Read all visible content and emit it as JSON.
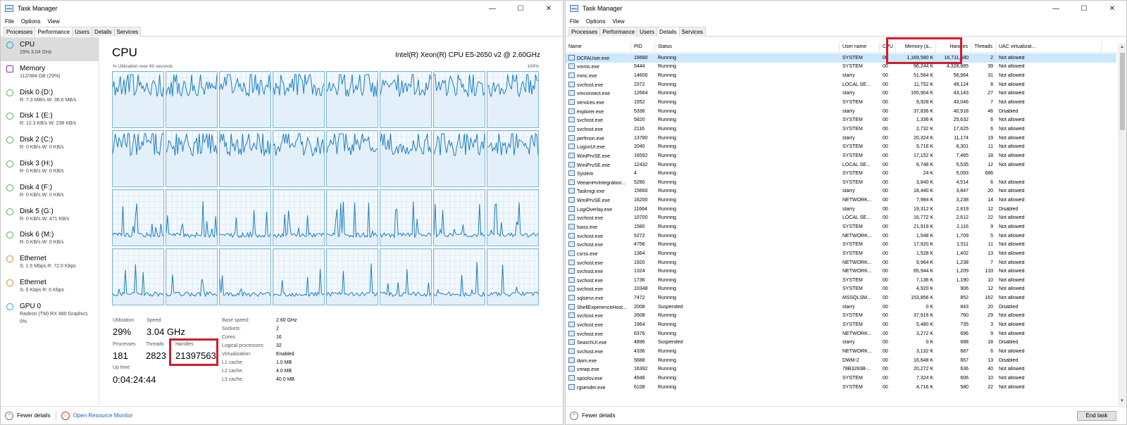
{
  "left": {
    "title": "Task Manager",
    "menu": [
      "File",
      "Options",
      "View"
    ],
    "tabs": [
      "Processes",
      "Performance",
      "Users",
      "Details",
      "Services"
    ],
    "active_tab": "Performance",
    "sidebar": [
      {
        "name": "CPU",
        "sub": "29% 3.04 GHz",
        "color": "#17a2d8",
        "active": true
      },
      {
        "name": "Memory",
        "sub": "112/384 GB (29%)",
        "color": "#8b2fb0"
      },
      {
        "name": "Disk 0 (D:)",
        "sub": "R: 7.3 MB/s W: 36.6 MB/s",
        "color": "#4caf50"
      },
      {
        "name": "Disk 1 (E:)",
        "sub": "R: 12.3 KB/s W: 238 KB/s",
        "color": "#4caf50"
      },
      {
        "name": "Disk 2 (C:)",
        "sub": "R: 0 KB/s W: 0 KB/s",
        "color": "#4caf50"
      },
      {
        "name": "Disk 3 (H:)",
        "sub": "R: 0 KB/s W: 0 KB/s",
        "color": "#4caf50"
      },
      {
        "name": "Disk 4 (F:)",
        "sub": "R: 0 KB/s W: 0 KB/s",
        "color": "#4caf50"
      },
      {
        "name": "Disk 5 (G:)",
        "sub": "R: 0 KB/s W: 471 KB/s",
        "color": "#4caf50"
      },
      {
        "name": "Disk 6 (M:)",
        "sub": "R: 0 KB/s W: 0 KB/s",
        "color": "#4caf50"
      },
      {
        "name": "Ethernet",
        "sub": "S: 1.5 Mbps R: 72.0 Kbps",
        "color": "#d9822b"
      },
      {
        "name": "Ethernet",
        "sub": "S: 0 Kbps R: 0 Kbps",
        "color": "#d9822b"
      },
      {
        "name": "GPU 0",
        "sub": "Radeon (TM) RX 480 Graphics",
        "sub2": "0%",
        "color": "#17a2d8"
      }
    ],
    "cpu": {
      "title": "CPU",
      "model": "Intel(R) Xeon(R) CPU E5-2650 v2 @ 2.60GHz",
      "util_label": "% Utilization over 60 seconds",
      "util_max": "100%",
      "utilization_label": "Utilization",
      "utilization": "29%",
      "speed_label": "Speed",
      "speed": "3.04 GHz",
      "processes_label": "Processes",
      "processes": "181",
      "threads_label": "Threads",
      "threads": "2823",
      "handles_label": "Handles",
      "handles": "21397563",
      "uptime_label": "Up time",
      "uptime": "0:04:24:44",
      "specs": [
        {
          "k": "Base speed:",
          "v": "2.60 GHz"
        },
        {
          "k": "Sockets:",
          "v": "2"
        },
        {
          "k": "Cores:",
          "v": "16"
        },
        {
          "k": "Logical processors:",
          "v": "32"
        },
        {
          "k": "Virtualization:",
          "v": "Enabled"
        },
        {
          "k": "L1 cache:",
          "v": "1.0 MB"
        },
        {
          "k": "L2 cache:",
          "v": "4.0 MB"
        },
        {
          "k": "L3 cache:",
          "v": "40.0 MB"
        }
      ]
    },
    "footer": {
      "fewer": "Fewer details",
      "open_rm": "Open Resource Monitor"
    }
  },
  "right": {
    "title": "Task Manager",
    "menu": [
      "File",
      "Options",
      "View"
    ],
    "tabs": [
      "Processes",
      "Performance",
      "Users",
      "Details",
      "Services"
    ],
    "active_tab": "Details",
    "columns": [
      "Name",
      "PID",
      "Status",
      "User name",
      "CPU",
      "Memory (a...",
      "Handles",
      "Threads",
      "UAC virtualizat..."
    ],
    "rows": [
      [
        "DCFAUser.exe",
        "16680",
        "Running",
        "SYSTEM",
        "00",
        "1,169,580 K",
        "16,711,680",
        "2",
        "Not allowed"
      ],
      [
        "vmms.exe",
        "5444",
        "Running",
        "SYSTEM",
        "00",
        "96,244 K",
        "4,328,985",
        "39",
        "Not allowed"
      ],
      [
        "mmc.exe",
        "14600",
        "Running",
        "starry",
        "00",
        "51,564 K",
        "56,964",
        "31",
        "Not allowed"
      ],
      [
        "svchost.exe",
        "2372",
        "Running",
        "LOCAL SE...",
        "00",
        "11,752 K",
        "49,124",
        "8",
        "Not allowed"
      ],
      [
        "vmconnect.exe",
        "12664",
        "Running",
        "starry",
        "00",
        "165,904 K",
        "43,143",
        "27",
        "Not allowed"
      ],
      [
        "services.exe",
        "1552",
        "Running",
        "SYSTEM",
        "00",
        "9,928 K",
        "43,046",
        "7",
        "Not allowed"
      ],
      [
        "explorer.exe",
        "5336",
        "Running",
        "starry",
        "00",
        "37,836 K",
        "40,918",
        "46",
        "Disabled"
      ],
      [
        "svchost.exe",
        "5820",
        "Running",
        "SYSTEM",
        "00",
        "1,336 K",
        "25,632",
        "6",
        "Not allowed"
      ],
      [
        "svchost.exe",
        "2116",
        "Running",
        "SYSTEM",
        "00",
        "2,732 K",
        "17,625",
        "6",
        "Not allowed"
      ],
      [
        "perfmon.exe",
        "13780",
        "Running",
        "starry",
        "00",
        "20,324 K",
        "11,174",
        "19",
        "Not allowed"
      ],
      [
        "LogonUI.exe",
        "2040",
        "Running",
        "SYSTEM",
        "00",
        "9,716 K",
        "8,301",
        "11",
        "Not allowed"
      ],
      [
        "WmiPrvSE.exe",
        "16592",
        "Running",
        "SYSTEM",
        "00",
        "17,152 K",
        "7,465",
        "18",
        "Not allowed"
      ],
      [
        "WmiPrvSE.exe",
        "12432",
        "Running",
        "LOCAL SE...",
        "00",
        "6,748 K",
        "5,535",
        "12",
        "Not allowed"
      ],
      [
        "System",
        "4",
        "Running",
        "SYSTEM",
        "00",
        "24 K",
        "5,093",
        "686",
        ""
      ],
      [
        "VeeamHvIntegration...",
        "5280",
        "Running",
        "SYSTEM",
        "00",
        "3,840 K",
        "4,514",
        "6",
        "Not allowed"
      ],
      [
        "Taskmgr.exe",
        "15660",
        "Running",
        "starry",
        "00",
        "18,440 K",
        "3,847",
        "20",
        "Not allowed"
      ],
      [
        "WmiPrvSE.exe",
        "16200",
        "Running",
        "NETWORK...",
        "00",
        "7,984 K",
        "3,238",
        "14",
        "Not allowed"
      ],
      [
        "LogiOverlay.exe",
        "11664",
        "Running",
        "starry",
        "00",
        "19,312 K",
        "2,819",
        "12",
        "Disabled"
      ],
      [
        "svchost.exe",
        "10700",
        "Running",
        "LOCAL SE...",
        "00",
        "16,772 K",
        "2,612",
        "22",
        "Not allowed"
      ],
      [
        "lsass.exe",
        "1580",
        "Running",
        "SYSTEM",
        "00",
        "21,916 K",
        "2,116",
        "9",
        "Not allowed"
      ],
      [
        "svchost.exe",
        "5272",
        "Running",
        "NETWORK...",
        "00",
        "1,548 K",
        "1,709",
        "5",
        "Not allowed"
      ],
      [
        "svchost.exe",
        "4756",
        "Running",
        "SYSTEM",
        "00",
        "17,920 K",
        "1,511",
        "11",
        "Not allowed"
      ],
      [
        "csrss.exe",
        "1364",
        "Running",
        "SYSTEM",
        "00",
        "1,528 K",
        "1,402",
        "13",
        "Not allowed"
      ],
      [
        "svchost.exe",
        "1920",
        "Running",
        "NETWORK...",
        "00",
        "9,964 K",
        "1,238",
        "7",
        "Not allowed"
      ],
      [
        "svchost.exe",
        "1324",
        "Running",
        "NETWORK...",
        "00",
        "65,944 K",
        "1,209",
        "133",
        "Not allowed"
      ],
      [
        "svchost.exe",
        "1736",
        "Running",
        "SYSTEM",
        "00",
        "7,136 K",
        "1,190",
        "10",
        "Not allowed"
      ],
      [
        "svchost.exe",
        "10348",
        "Running",
        "SYSTEM",
        "00",
        "4,920 K",
        "906",
        "12",
        "Not allowed"
      ],
      [
        "sqlservr.exe",
        "7472",
        "Running",
        "MSSQLSM...",
        "00",
        "153,856 K",
        "852",
        "162",
        "Not allowed"
      ],
      [
        "ShellExperienceHost...",
        "2008",
        "Suspended",
        "starry",
        "00",
        "0 K",
        "843",
        "20",
        "Disabled"
      ],
      [
        "svchost.exe",
        "2608",
        "Running",
        "SYSTEM",
        "00",
        "37,916 K",
        "760",
        "29",
        "Not allowed"
      ],
      [
        "svchost.exe",
        "1964",
        "Running",
        "SYSTEM",
        "00",
        "5,480 K",
        "735",
        "3",
        "Not allowed"
      ],
      [
        "svchost.exe",
        "6376",
        "Running",
        "NETWORK...",
        "00",
        "3,272 K",
        "696",
        "9",
        "Not allowed"
      ],
      [
        "SearchUI.exe",
        "4896",
        "Suspended",
        "starry",
        "00",
        "0 K",
        "688",
        "18",
        "Disabled"
      ],
      [
        "svchost.exe",
        "4336",
        "Running",
        "NETWORK...",
        "00",
        "3,132 K",
        "687",
        "6",
        "Not allowed"
      ],
      [
        "dwm.exe",
        "5688",
        "Running",
        "DWM-2",
        "00",
        "16,648 K",
        "667",
        "13",
        "Disabled"
      ],
      [
        "vmwp.exe",
        "16392",
        "Running",
        "78B3283B-...",
        "00",
        "20,272 K",
        "636",
        "40",
        "Not allowed"
      ],
      [
        "spoolsv.exe",
        "4948",
        "Running",
        "SYSTEM",
        "00",
        "7,324 K",
        "606",
        "10",
        "Not allowed"
      ],
      [
        "rgsender.exe",
        "6108",
        "Running",
        "SYSTEM",
        "00",
        "4,716 K",
        "580",
        "22",
        "Not allowed"
      ]
    ],
    "footer": {
      "fewer": "Fewer details",
      "end_task": "End task"
    }
  }
}
